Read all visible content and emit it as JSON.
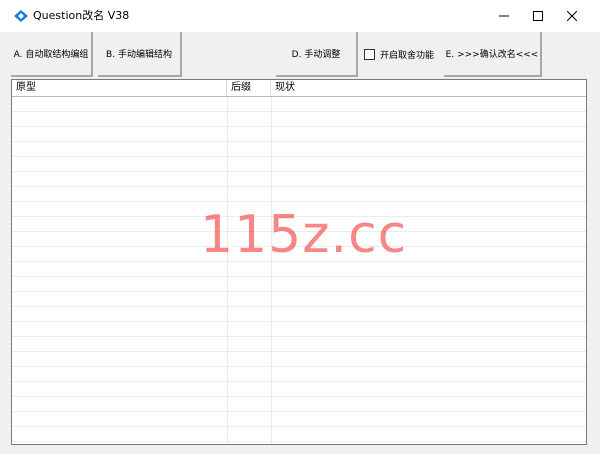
{
  "window": {
    "title": "Question改名 V38",
    "icon": "app-logo-icon",
    "controls": [
      "minimize-icon",
      "maximize-icon",
      "close-icon"
    ]
  },
  "toolbar": {
    "btn_auto": "A. 自动取结构编组",
    "btn_manual_edit": "B. 手动编辑结构",
    "btn_manual_adjust": "D. 手动调整",
    "checkbox_label": "开启取舍功能",
    "checkbox_checked": false,
    "btn_confirm": "E. >>>确认改名<<<"
  },
  "list": {
    "columns": [
      "原型",
      "后缀",
      "现状"
    ],
    "rows": []
  },
  "watermark": "115z.cc",
  "colors": {
    "accent": "#1e7fd8",
    "watermark": "#f04646"
  }
}
